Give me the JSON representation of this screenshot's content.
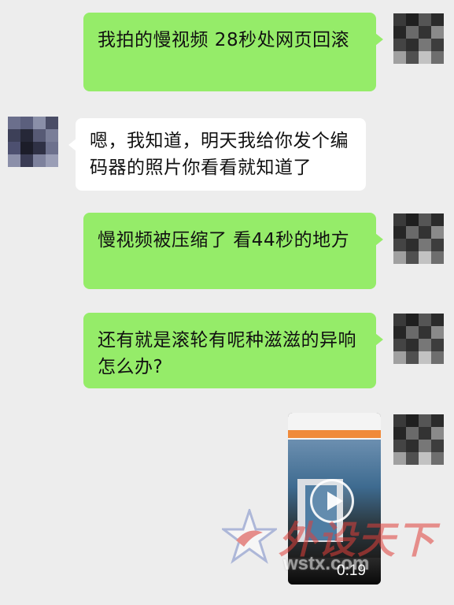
{
  "messages": [
    {
      "side": "right",
      "text": "我拍的慢视频  28秒处网页回滚"
    },
    {
      "side": "left",
      "text": "嗯，我知道，明天我给你发个编码器的照片你看看就知道了"
    },
    {
      "side": "right",
      "text": "慢视频被压缩了  看44秒的地方"
    },
    {
      "side": "right",
      "text": "还有就是滚轮有呢种滋滋的异响怎么办?"
    }
  ],
  "video": {
    "duration": "0:19"
  },
  "watermark": {
    "title": "外设天下",
    "url": "wstx.com"
  },
  "colors": {
    "background": "#ededed",
    "sent_bubble": "#95ec69",
    "received_bubble": "#ffffff"
  }
}
